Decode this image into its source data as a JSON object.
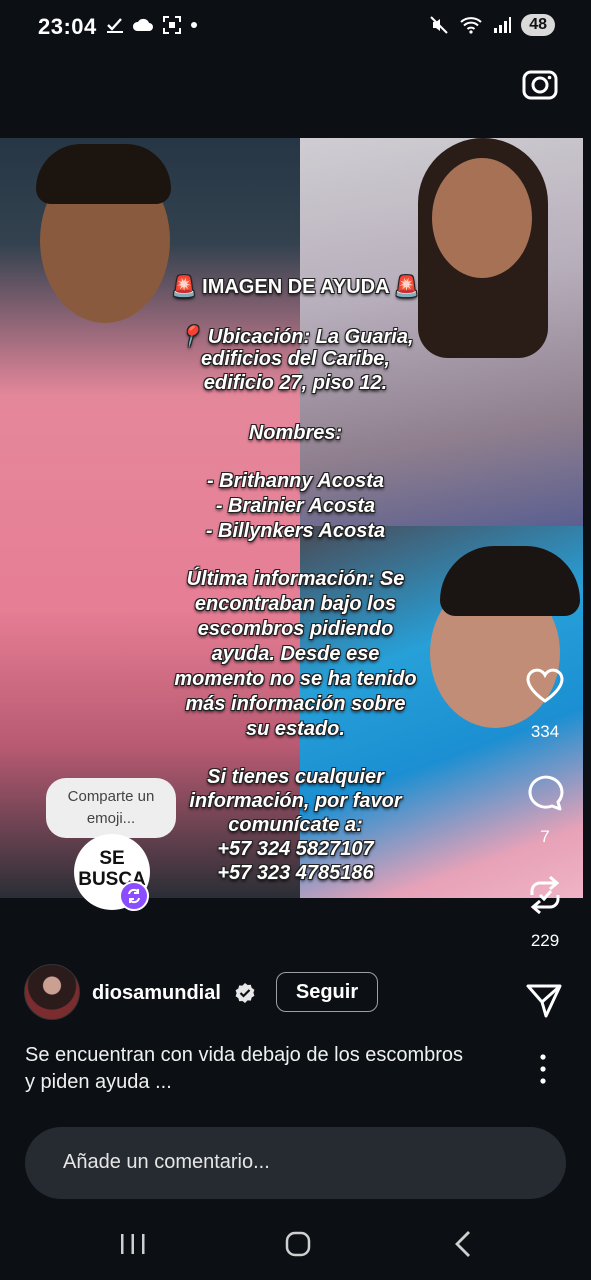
{
  "status_bar": {
    "time": "23:04",
    "battery": "48"
  },
  "post_image": {
    "title": "IMAGEN DE AYUDA",
    "location_lines": [
      "Ubicación: La Guaria,",
      "edificios del Caribe,",
      "edificio 27, piso 12."
    ],
    "names_heading": "Nombres:",
    "names": [
      "- Brithanny Acosta",
      "- Brainier Acosta",
      "- Billynkers Acosta"
    ],
    "info_lines": [
      "Última información: Se",
      "encontraban bajo los",
      "escombros pidiendo",
      "ayuda. Desde ese",
      "momento no se ha tenido",
      "más información sobre",
      "su estado."
    ],
    "contact_lines": [
      "Si tienes cualquier",
      "información, por favor",
      "comunícate a:"
    ],
    "phones": [
      "+57 324 5827107",
      "+57 323 4785186"
    ]
  },
  "emoji_prompt": {
    "line1": "Comparte un",
    "line2": "emoji..."
  },
  "sticker": {
    "line1": "SE",
    "line2": "BUSCA"
  },
  "actions": {
    "likes": "334",
    "comments": "7",
    "reposts": "229"
  },
  "author": {
    "username": "diosamundial",
    "follow_label": "Seguir"
  },
  "caption": {
    "line1": "Se encuentran con vida debajo de los escombros",
    "line2": "y piden ayuda ..."
  },
  "comment_input": {
    "placeholder": "Añade un comentario..."
  },
  "colors": {
    "background": "#0c1014",
    "overlay_text": "#ffffff",
    "input_bg": "#262b31"
  }
}
